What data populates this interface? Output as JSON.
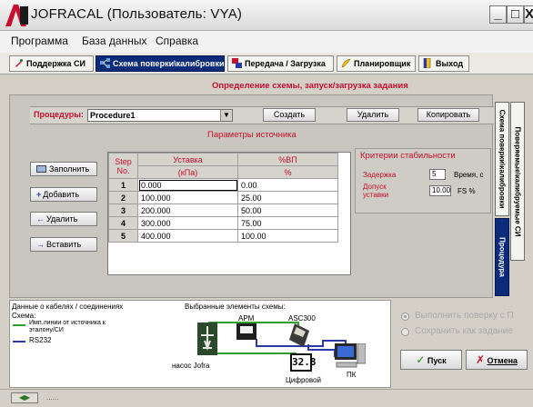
{
  "window": {
    "title": "JOFRACAL (Пользователь: VYA)",
    "minimize": "_",
    "maximize": "□",
    "close": "X"
  },
  "menu": {
    "items": [
      "Программа",
      "База данных",
      "Справка"
    ]
  },
  "tabs": [
    {
      "label": "Поддержка СИ",
      "icon": "wrench-icon"
    },
    {
      "label": "Схема поверки\\калибровки",
      "icon": "diagram-icon",
      "active": true
    },
    {
      "label": "Передача / Загрузка",
      "icon": "transfer-icon"
    },
    {
      "label": "Планировщик",
      "icon": "scheduler-icon"
    },
    {
      "label": "Выход",
      "icon": "exit-icon"
    }
  ],
  "main": {
    "heading": "Определение схемы, запуск/загрузка задания",
    "procedures_label": "Процедуры:",
    "procedure_value": "Procedure1",
    "create_label": "Создать",
    "delete_label": "Удалить",
    "copy_label": "Копировать",
    "source_params_title": "Параметры источника"
  },
  "left_buttons": {
    "fill": "Заполнить",
    "add": "Добавить",
    "remove": "Удалить",
    "insert": "Вставить"
  },
  "table": {
    "col_step": "Step",
    "col_no": "No.",
    "col_setpoint": "Уставка",
    "col_setpoint_unit": "(кПа)",
    "col_percent": "%ВП",
    "col_percent_unit": "%",
    "rows": [
      {
        "n": "1",
        "setpoint": "0.000",
        "percent": "0.00"
      },
      {
        "n": "2",
        "setpoint": "100.000",
        "percent": "25.00"
      },
      {
        "n": "3",
        "setpoint": "200.000",
        "percent": "50.00"
      },
      {
        "n": "4",
        "setpoint": "300.000",
        "percent": "75.00"
      },
      {
        "n": "5",
        "setpoint": "400.000",
        "percent": "100.00"
      }
    ]
  },
  "stability": {
    "title": "Критерии стабильности",
    "delay_label": "Задержка",
    "delay_value": "5",
    "time_unit": "Время, с",
    "tolerance_label_1": "Допуск",
    "tolerance_label_2": "уставки",
    "tolerance_value": "10.00",
    "tolerance_unit": "FS %"
  },
  "side_tabs": {
    "scheme": "Схема поверки\\калибровки",
    "verified": "Поверяемые\\калибруемые СИ",
    "procedures": "Процедура"
  },
  "diagram": {
    "cables_title": "Данные о кабелях / соединениях",
    "scheme_label": "Схема:",
    "legend_line_1a": "Имп.линии от источника к",
    "legend_line_1b": "эталону/СИ",
    "legend_line_2": "RS232",
    "selected_title": "Выбранные элементы схемы:",
    "apm": "АРМ",
    "asc": "ASC300",
    "pump": "насос Jofra",
    "digital": "Цифровой",
    "digital_display": "32.8",
    "pc": "ПК"
  },
  "actions": {
    "run_verification": "Выполнить поверку с П",
    "save_task": "Сохранить как задание",
    "start": "Пуск",
    "cancel": "Отмена"
  },
  "status": {
    "text": "......"
  },
  "colors": {
    "accent_red": "#c8102e",
    "active_tab": "#0a2a7a",
    "line_green": "#2e9e2e",
    "line_blue": "#2a3aa8"
  }
}
